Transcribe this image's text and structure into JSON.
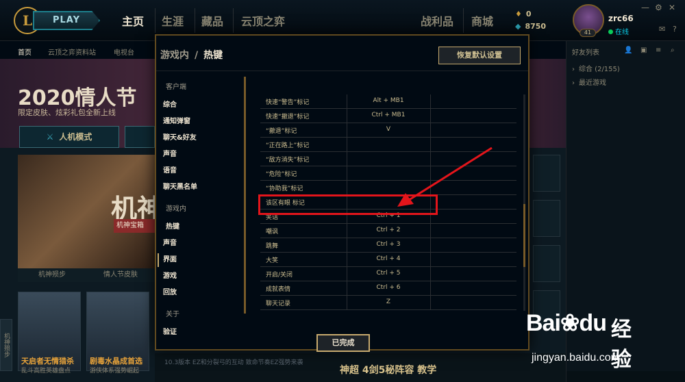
{
  "topbar": {
    "logo": "L",
    "play": "PLAY",
    "nav": [
      "主页",
      "生涯",
      "藏品",
      "云顶之弈",
      "战利品",
      "商城"
    ],
    "currency": {
      "rp": "0",
      "be": "8750"
    },
    "username": "zrc66",
    "status": "在线",
    "level": "41",
    "window": {
      "min": "—",
      "settings": "⚙",
      "help": "?",
      "close": "✕"
    }
  },
  "subnav": [
    "首页",
    "云顶之弈资料站",
    "电视台"
  ],
  "home": {
    "banner_title": "2020情人节",
    "banner_sub": "限定皮肤、炫彩礼包全新上线",
    "mode_btn": "人机模式",
    "feature_text": "机神",
    "feature_badge": "机神宝箱",
    "feature_labels": [
      "机神殒步",
      "情人节皮肤"
    ],
    "cards": [
      {
        "caption": "天启者无情猎杀",
        "sub": "乱斗高胜英雄盘点"
      },
      {
        "caption": "剧毒水晶成首选",
        "sub": "游侠体系强势崛起"
      }
    ],
    "side_tab": "机神殒步",
    "news": "10.3版本 EZ和分裂弓的互动 致命节奏EZ强势来袭",
    "ad": "神超 4剑5秘阵容 教学"
  },
  "friends": {
    "title": "好友列表",
    "groups": [
      {
        "label": "综合 (2/155)"
      },
      {
        "label": "最近游戏"
      }
    ]
  },
  "modal": {
    "breadcrumb_parent": "游戏内",
    "breadcrumb_sep": "/",
    "breadcrumb_current": "热键",
    "reset": "恢复默认设置",
    "done": "已完成",
    "nav": {
      "client_group": "客户端",
      "client_items": [
        "综合",
        "通知弹窗",
        "聊天&好友",
        "声音",
        "语音",
        "聊天黑名单"
      ],
      "ingame_group": "游戏内",
      "ingame_items": [
        "热键",
        "声音",
        "界面",
        "游戏",
        "回放"
      ],
      "about_group": "关于",
      "about_items": [
        "验证"
      ]
    },
    "hotkeys": [
      {
        "action": "快速“警告”标记",
        "key": "Alt + MB1"
      },
      {
        "action": "快速“撤退”标记",
        "key": "Ctrl + MB1"
      },
      {
        "action": "“撤退”标记",
        "key": "V"
      },
      {
        "action": "“正在路上”标记",
        "key": ""
      },
      {
        "action": "“敌方消失”标记",
        "key": ""
      },
      {
        "action": "“危险”标记",
        "key": ""
      },
      {
        "action": "“协助我”标记",
        "key": ""
      },
      {
        "action": "该区有眼 标记",
        "key": ""
      },
      {
        "action": "笑话",
        "key": "Ctrl + 1"
      },
      {
        "action": "嘲讽",
        "key": "Ctrl + 2"
      },
      {
        "action": "跳舞",
        "key": "Ctrl + 3"
      },
      {
        "action": "大笑",
        "key": "Ctrl + 4"
      },
      {
        "action": "开启/关闭",
        "key": "Ctrl + 5"
      },
      {
        "action": "成就表情",
        "key": "Ctrl + 6"
      },
      {
        "action": "聊天记录",
        "key": "Z"
      }
    ]
  },
  "annotation": {
    "color": "#e3151b"
  },
  "watermark": {
    "logo": "Bai",
    "logo2": "du",
    "brand": "经验",
    "url": "jingyan.baidu.com"
  },
  "colors": {
    "gold": "#c8aa6e",
    "bg": "#010a13",
    "text": "#cdbe91",
    "accent": "#0acbe6"
  }
}
